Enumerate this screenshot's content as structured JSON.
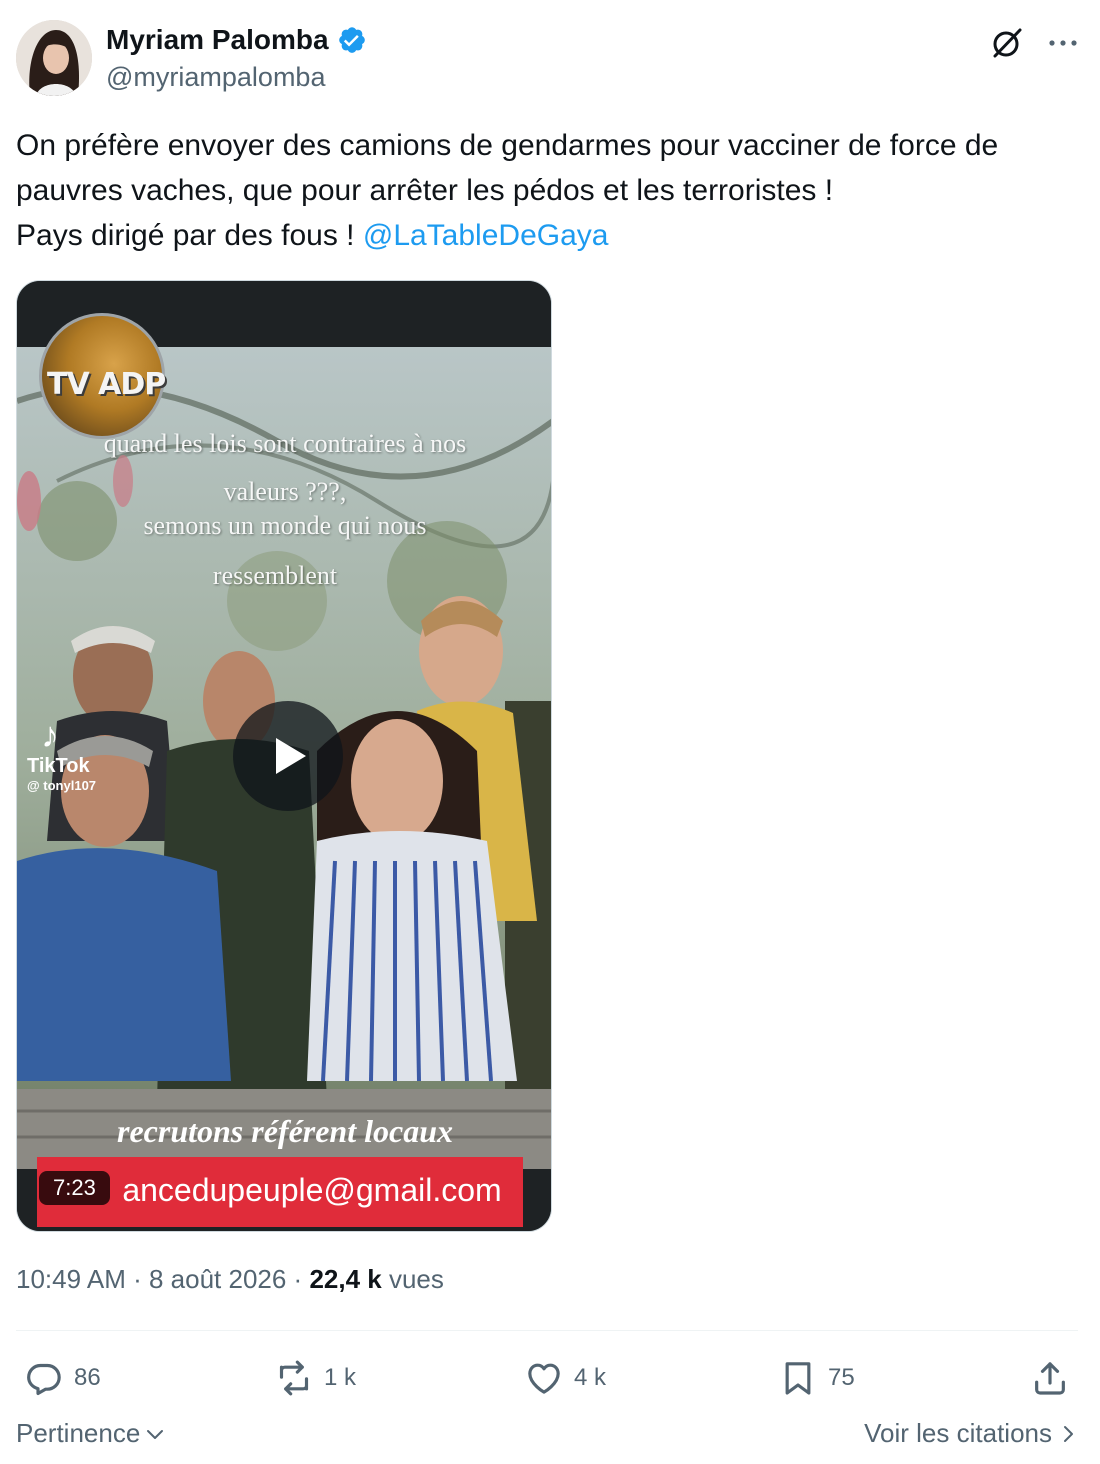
{
  "author": {
    "display_name": "Myriam Palomba",
    "handle": "@myriampalomba",
    "verified": true
  },
  "tweet": {
    "line1": "On préfère envoyer des camions de gendarmes pour vacciner de force de",
    "line2": "pauvres vaches, que pour arrêter les pédos et les terroristes !",
    "line3_text": "Pays dirigé par des fous ! ",
    "mention": "@LaTableDeGaya"
  },
  "media": {
    "logo_text": "TV ADP",
    "overlay_lines": [
      "quand les lois sont contraires à nos",
      "valeurs ???,",
      "semons un monde qui nous",
      "ressemblent"
    ],
    "tiktok_label": "TikTok",
    "tiktok_user": "@ tonyl107",
    "recruit_text": "recrutons référent locaux",
    "email_text": "ancedupeuple@gmail.com",
    "duration": "7:23"
  },
  "meta": {
    "time": "10:49 AM",
    "sep1": " · ",
    "date": "8 août 2026",
    "sep2": " · ",
    "views_count": "22,4 k",
    "views_label": " vues"
  },
  "actions": {
    "replies": "86",
    "reposts": "1 k",
    "likes": "4 k",
    "bookmarks": "75"
  },
  "footer": {
    "sort_label": "Pertinence",
    "quotes_label": "Voir les citations"
  },
  "colors": {
    "accent": "#1d9bf0",
    "secondary_text": "#536471",
    "email_bar": "#e02c3a"
  }
}
